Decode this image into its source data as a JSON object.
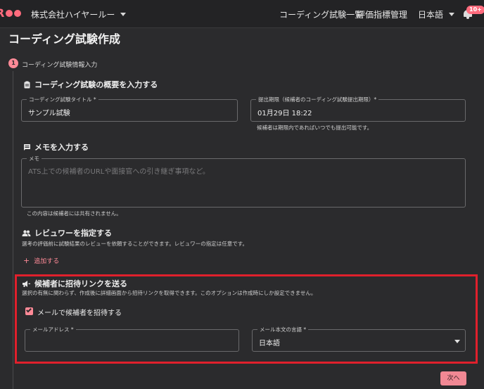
{
  "header": {
    "company": "株式会社ハイヤールー",
    "nav": [
      "コーディング試験一覧",
      "評価指標管理"
    ],
    "language": "日本語",
    "notification_badge": "10+",
    "accent": "#ff6b7d"
  },
  "page": {
    "title": "コーディング試験作成",
    "step_number": "1",
    "step_label": "コーディング試験情報入力"
  },
  "overview": {
    "title": "コーディング試験の概要を入力する",
    "name_label": "コーディング試験タイトル *",
    "name_value": "サンプル試験",
    "deadline_label": "提出期限（候補者のコーディング試験提出期限）*",
    "deadline_value": "01月29日 18:22",
    "deadline_helper": "候補者は期限内であればいつでも提出可能です。"
  },
  "memo": {
    "title": "メモを入力する",
    "label": "メモ",
    "placeholder": "ATS上での候補者のURLや面接官への引き継ぎ事項など。",
    "helper": "この内容は候補者には共有されません。"
  },
  "reviewer": {
    "title": "レビュワーを指定する",
    "desc": "選考の評価前に試験結果のレビューを依頼することができます。レビュワーの指定は任意です。",
    "add_label": "追加する"
  },
  "invite": {
    "title": "候補者に招待リンクを送る",
    "desc": "選択の有無に関わらず、作成後に詳細画面から招待リンクを取得できます。このオプションは作成時にしか設定できません。",
    "checkbox_label": "メールで候補者を招待する",
    "checkbox_checked": true,
    "email_label": "メールアドレス *",
    "email_value": "",
    "lang_label": "メール本文の言語 *",
    "lang_value": "日本語",
    "highlight_color": "#e0202c"
  },
  "footer": {
    "next_label": "次へ"
  }
}
